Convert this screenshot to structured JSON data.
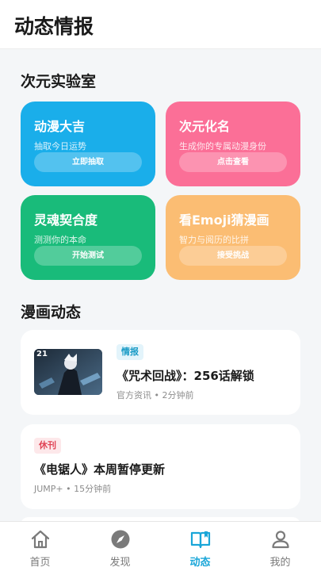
{
  "header": {
    "title": "动态情报"
  },
  "lab": {
    "title": "次元实验室",
    "cards": [
      {
        "title": "动漫大吉",
        "subtitle": "抽取今日运势",
        "button": "立即抽取",
        "color": "#1aaeea"
      },
      {
        "title": "次元化名",
        "subtitle": "生成你的专属动漫身份",
        "button": "点击查看",
        "color": "#fb6f97"
      },
      {
        "title": "灵魂契合度",
        "subtitle": "测测你的本命",
        "button": "开始测试",
        "color": "#19bb7a"
      },
      {
        "title": "看Emoji猜漫画",
        "subtitle": "智力与阅历的比拼",
        "button": "接受挑战",
        "color": "#fbbd73"
      }
    ]
  },
  "news": {
    "title": "漫画动态",
    "items": [
      {
        "tag": "情报",
        "title": "《咒术回战》：256话解锁",
        "meta": "官方资讯 • 2分钟前",
        "thumb_number": "21"
      },
      {
        "tag": "休刊",
        "title": "《电锯人》本周暂停更新",
        "meta": "JUMP+ • 15分钟前"
      }
    ]
  },
  "tabs": [
    {
      "label": "首页",
      "icon": "home-icon"
    },
    {
      "label": "发现",
      "icon": "compass-icon"
    },
    {
      "label": "动态",
      "icon": "book-icon",
      "active": true
    },
    {
      "label": "我的",
      "icon": "user-icon"
    }
  ],
  "colors": {
    "accent": "#1aa6d8",
    "inactive": "#7a7a7a"
  }
}
